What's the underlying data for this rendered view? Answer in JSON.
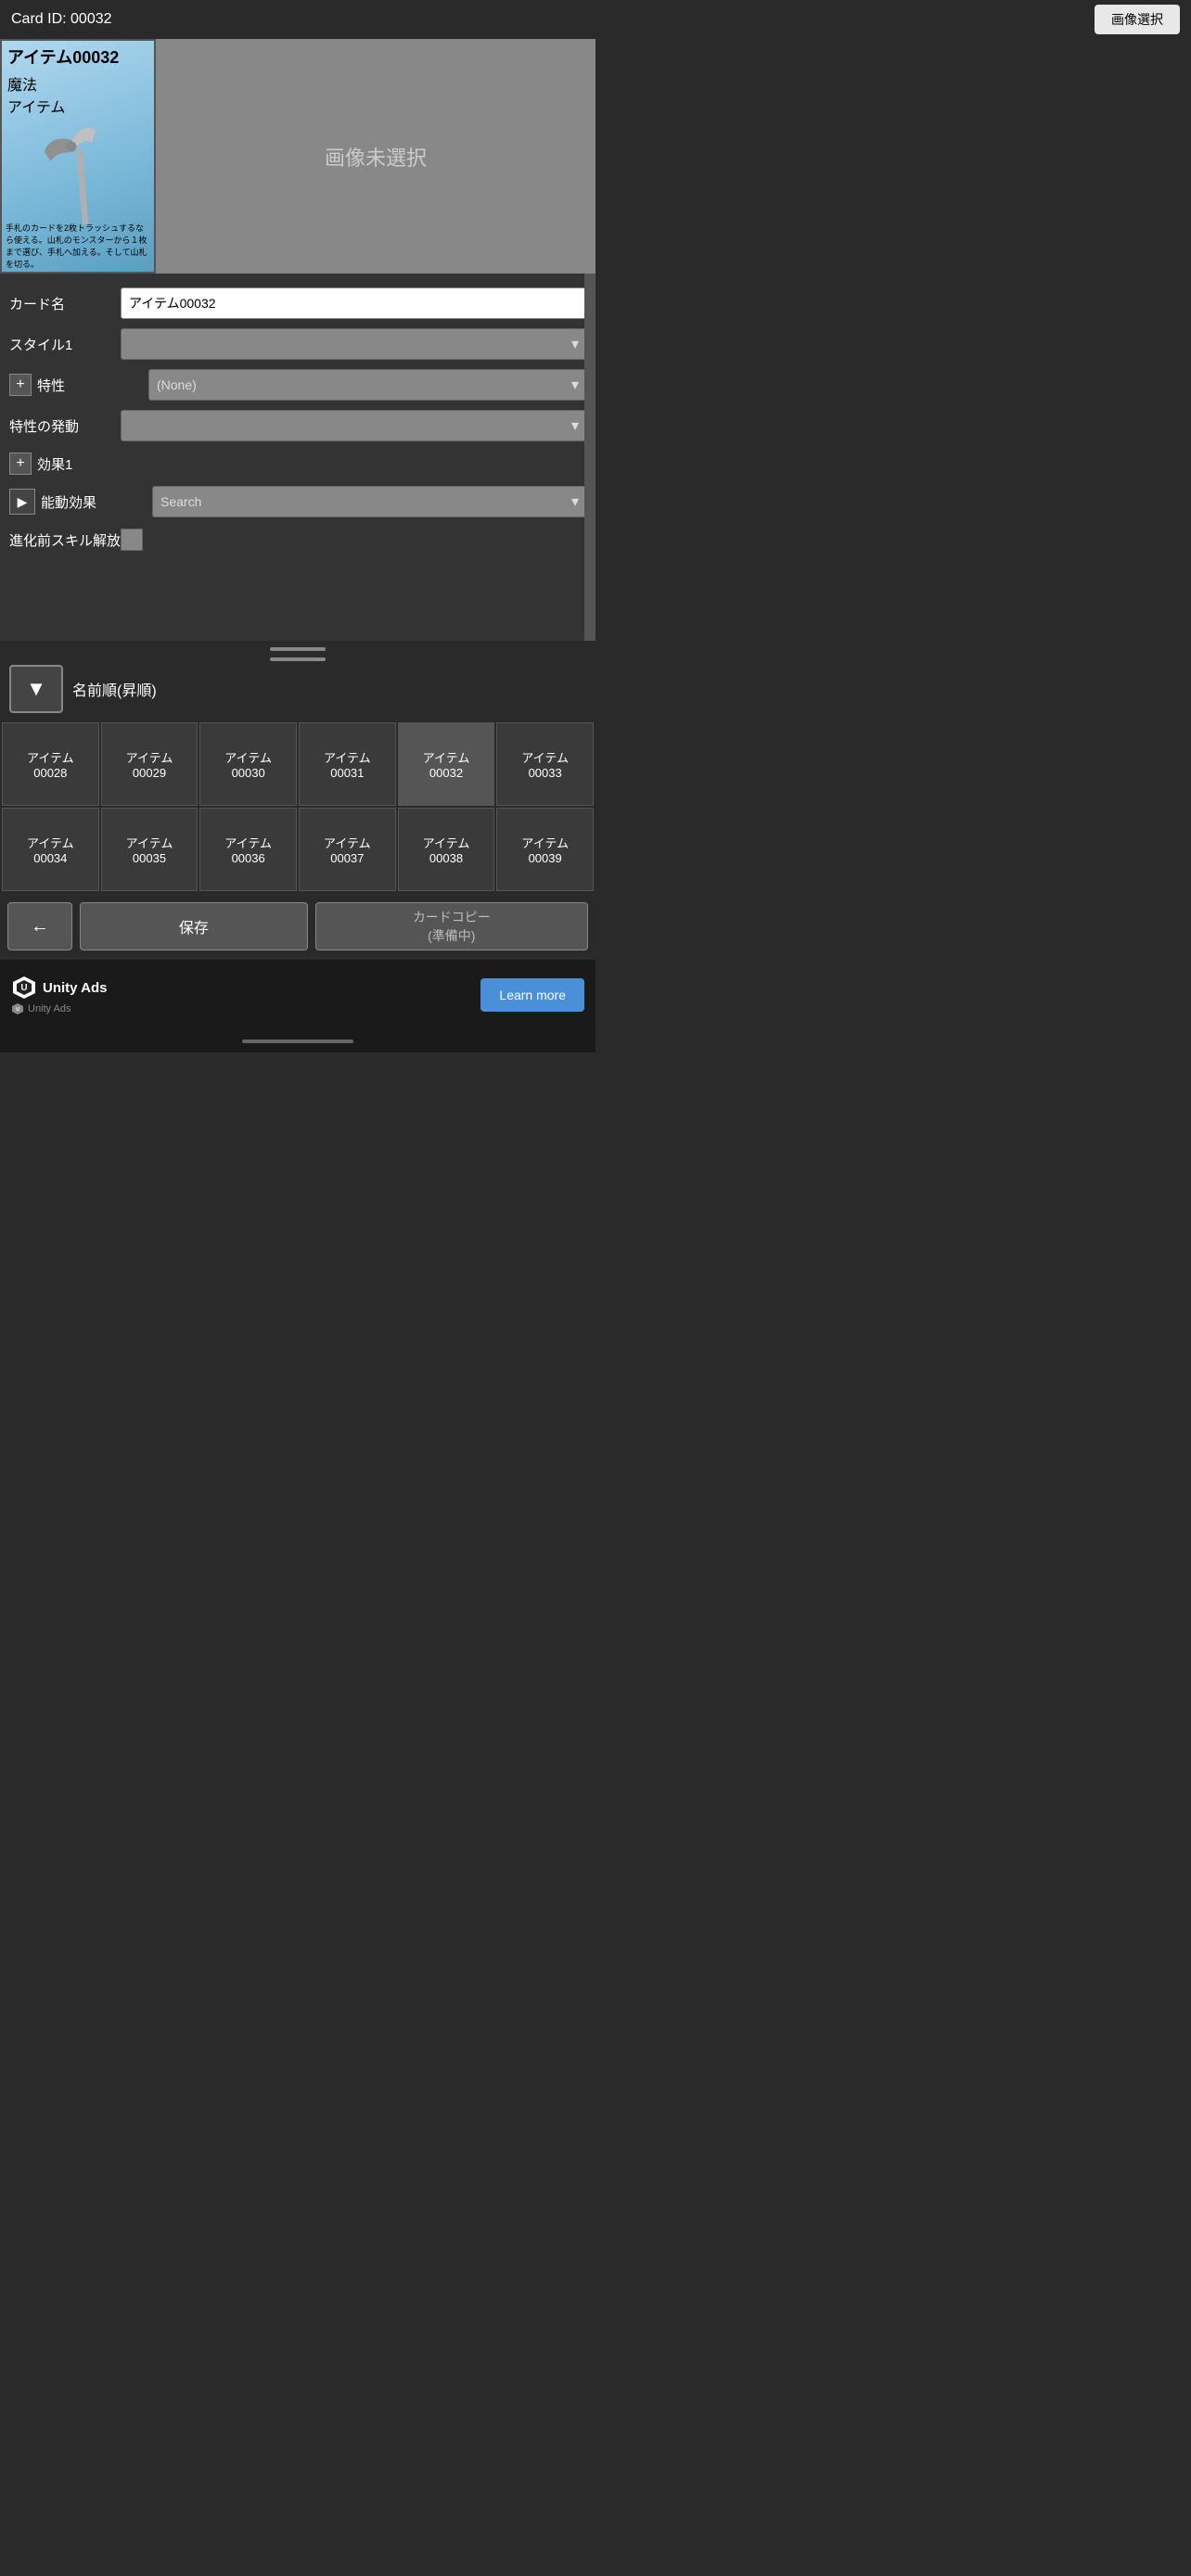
{
  "card": {
    "id": "Card ID: 00032",
    "title": "アイテム00032",
    "type1": "魔法",
    "type2": "アイテム",
    "description": "手札のカードを2枚トラッシュするなら使える。山札のモンスターから１枚まで選び、手札へ加える。そして山札を切る。",
    "no_image_text": "画像未選択"
  },
  "buttons": {
    "image_select": "画像選択",
    "save": "保存",
    "back": "←",
    "copy": "カードコピー\n(準備中)"
  },
  "form": {
    "card_name_label": "カード名",
    "card_name_value": "アイテム00032",
    "style1_label": "スタイル1",
    "trait_label": "特性",
    "trait_value": "(None)",
    "trait_trigger_label": "特性の発動",
    "effect1_label": "効果1",
    "passive_effect_label": "能動効果",
    "passive_effect_placeholder": "Search",
    "pre_evo_label": "進化前スキル解放"
  },
  "sort": {
    "label": "名前順(昇順)"
  },
  "grid": {
    "items": [
      {
        "id": "アイテム\n00028"
      },
      {
        "id": "アイテム\n00029"
      },
      {
        "id": "アイテム\n00030"
      },
      {
        "id": "アイテム\n00031"
      },
      {
        "id": "アイテム\n00032"
      },
      {
        "id": "アイテム\n00033"
      },
      {
        "id": "アイテム\n00034"
      },
      {
        "id": "アイテム\n00035"
      },
      {
        "id": "アイテム\n00036"
      },
      {
        "id": "アイテム\n00037"
      },
      {
        "id": "アイテム\n00038"
      },
      {
        "id": "アイテム\n00039"
      }
    ]
  },
  "ads": {
    "brand": "Unity Ads",
    "sub": "Unity  Ads",
    "learn_more": "Learn more"
  }
}
